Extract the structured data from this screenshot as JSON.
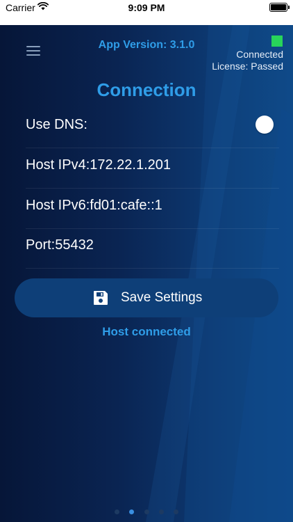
{
  "status_bar": {
    "carrier": "Carrier",
    "time": "9:09 PM",
    "wifi_icon": "wifi-icon",
    "battery_icon": "battery-icon"
  },
  "header": {
    "menu_icon": "hamburger-menu-icon",
    "app_version": "App Version: 3.1.0",
    "connection_indicator_color": "#28d45a",
    "connection_status": "Connected",
    "license_status": "License: Passed"
  },
  "page_title": "Connection",
  "settings": {
    "use_dns_label": "Use DNS:",
    "host_ipv4": "Host IPv4:172.22.1.201",
    "host_ipv6": "Host IPv6:fd01:cafe::1",
    "port": "Port:55432"
  },
  "save_button": {
    "label": "Save Settings",
    "icon": "floppy-disk-icon"
  },
  "host_status": "Host connected",
  "pagination": {
    "count": 5,
    "active_index": 1
  },
  "colors": {
    "accent": "#2f9de8",
    "background_dark": "#061638",
    "background_light": "#0e4a88",
    "button": "#0e3f78",
    "indicator_green": "#28d45a"
  }
}
